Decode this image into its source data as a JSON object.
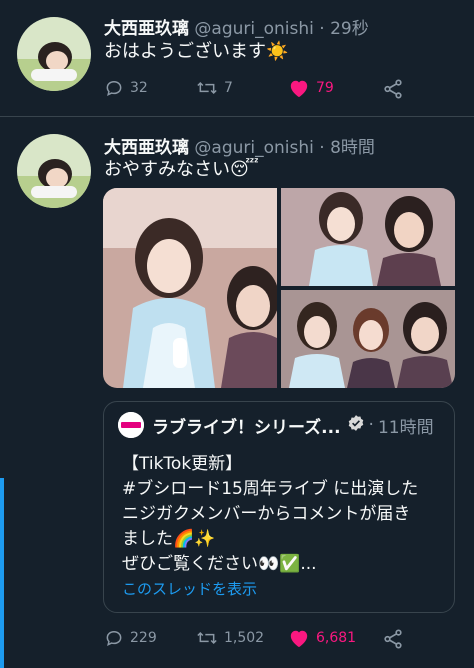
{
  "tweets": [
    {
      "name": "大西亜玖璃",
      "handle": "@aguri_onishi",
      "dot": "·",
      "time": "29秒",
      "text": "おはようございます☀️",
      "reply_count": "32",
      "retweet_count": "7",
      "like_count": "79",
      "liked": true
    },
    {
      "name": "大西亜玖璃",
      "handle": "@aguri_onishi",
      "dot": "·",
      "time": "8時間",
      "text": "おやすみなさい😴",
      "reply_count": "229",
      "retweet_count": "1,502",
      "like_count": "6,681",
      "liked": true,
      "quote": {
        "name": "ラブライブ！シリーズ...",
        "verified": true,
        "dot": "·",
        "time": "11時間",
        "lines": [
          "【TikTok更新】",
          "#ブシロード15周年ライブ に出演した",
          "ニジガクメンバーからコメントが届き",
          "ました🌈✨",
          "ぜひご覧ください👀✅..."
        ],
        "thread_link": "このスレッドを表示"
      }
    }
  ],
  "colors": {
    "background": "#15202b",
    "like_pink": "#f91880",
    "link_blue": "#1d9bf0",
    "muted_gray": "#8b98a5",
    "divider": "#38444d"
  }
}
